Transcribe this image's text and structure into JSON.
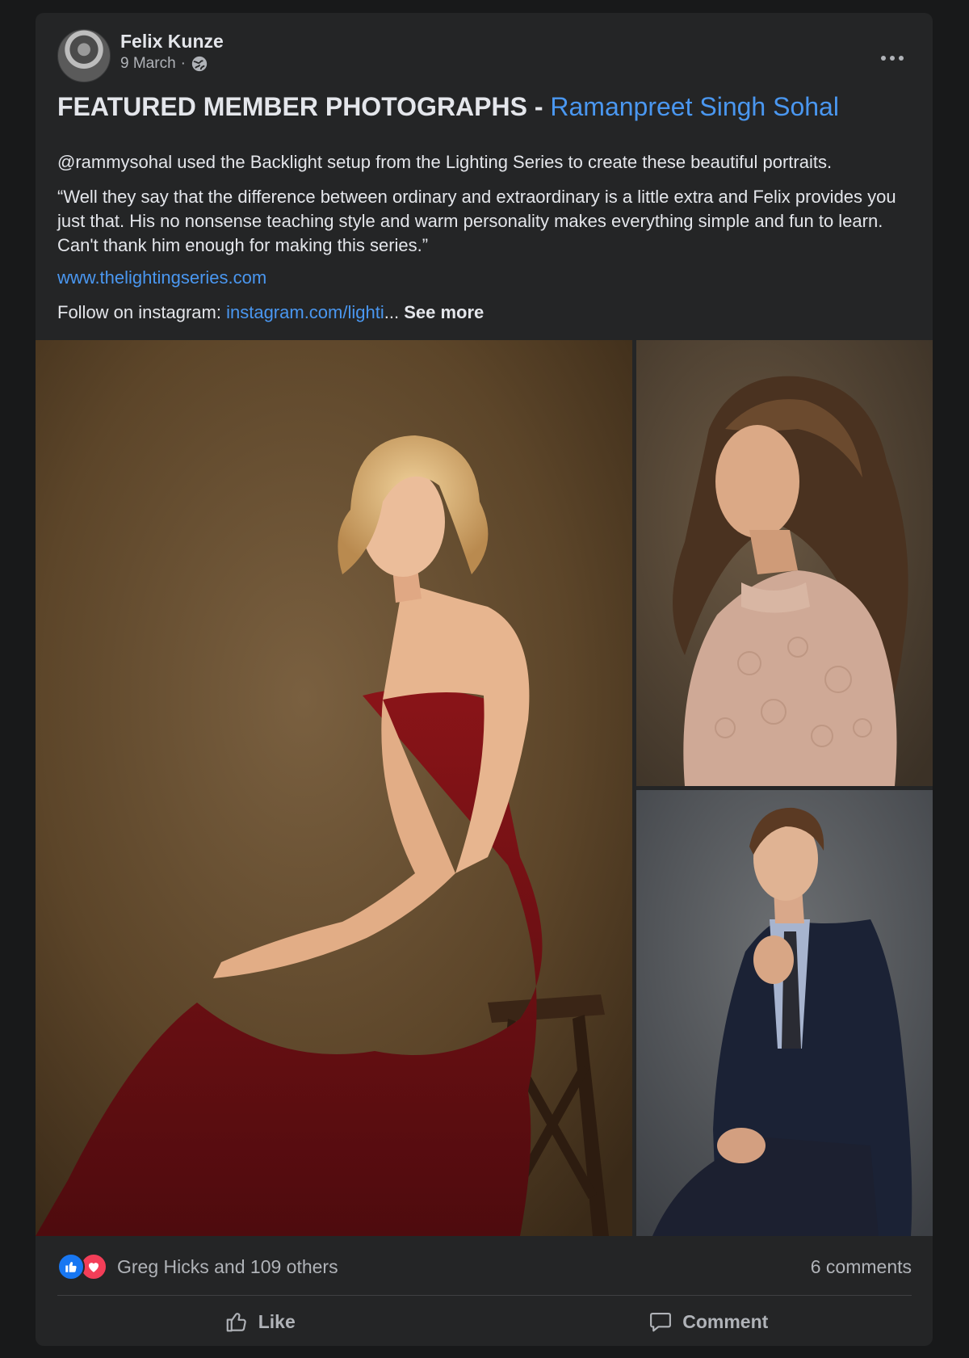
{
  "post": {
    "author": "Felix Kunze",
    "date": "9 March",
    "date_separator": "·",
    "title_bold": "FEATURED MEMBER PHOTOGRAPHS - ",
    "title_link": "Ramanpreet Singh Sohal",
    "paragraph1": "@rammysohal used the Backlight setup from the Lighting Series to create these beautiful portraits.",
    "paragraph2": "“Well they say that the difference between ordinary and extraordinary is a little extra and Felix provides you just that. His no nonsense teaching style and warm personality makes everything simple and fun to learn. Can't thank him enough for making this series.”",
    "website_link": "www.thelightingseries.com",
    "instagram_prefix": "Follow on instagram: ",
    "instagram_link": "instagram.com/lighti",
    "ellipsis": "...",
    "see_more": "See more"
  },
  "icons": {
    "audience": "public-globe-icon",
    "more": "more-options-icon",
    "reaction_like": "like-reaction-icon",
    "reaction_love": "love-reaction-icon",
    "like_action": "thumbs-up-icon",
    "comment_action": "comment-bubble-icon"
  },
  "photos": [
    {
      "subject": "woman in red strapless dress seated on wooden stool"
    },
    {
      "subject": "woman with long wavy hair in lace blouse"
    },
    {
      "subject": "young man in navy suit adjusting tie"
    }
  ],
  "reactions": {
    "summary": "Greg Hicks and 109 others",
    "comments": "6 comments"
  },
  "actions": {
    "like": "Like",
    "comment": "Comment"
  },
  "colors": {
    "background": "#18191a",
    "card": "#242526",
    "link": "#4a97f0",
    "secondary_text": "#b0b3b8",
    "like_blue": "#1877f2",
    "love_red": "#f33e58"
  }
}
